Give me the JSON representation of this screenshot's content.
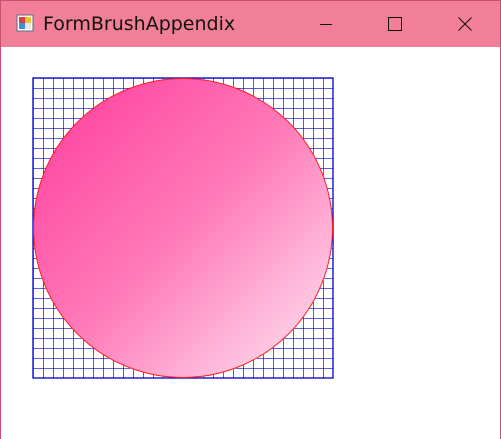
{
  "window": {
    "title": "FormBrushAppendix",
    "titlebar_color": "#f17f98",
    "border_color": "#c9506e"
  },
  "titlebar_controls": {
    "minimize_icon": "minimize-icon",
    "maximize_icon": "maximize-icon",
    "close_icon": "close-icon"
  },
  "canvas": {
    "grid_pattern_color": "#0000cc",
    "grid_background": "#ffffff",
    "circle_gradient_start": "#ff3a9e",
    "circle_gradient_end": "#ffe8f4",
    "circle_outline_color": "#ff2020"
  }
}
